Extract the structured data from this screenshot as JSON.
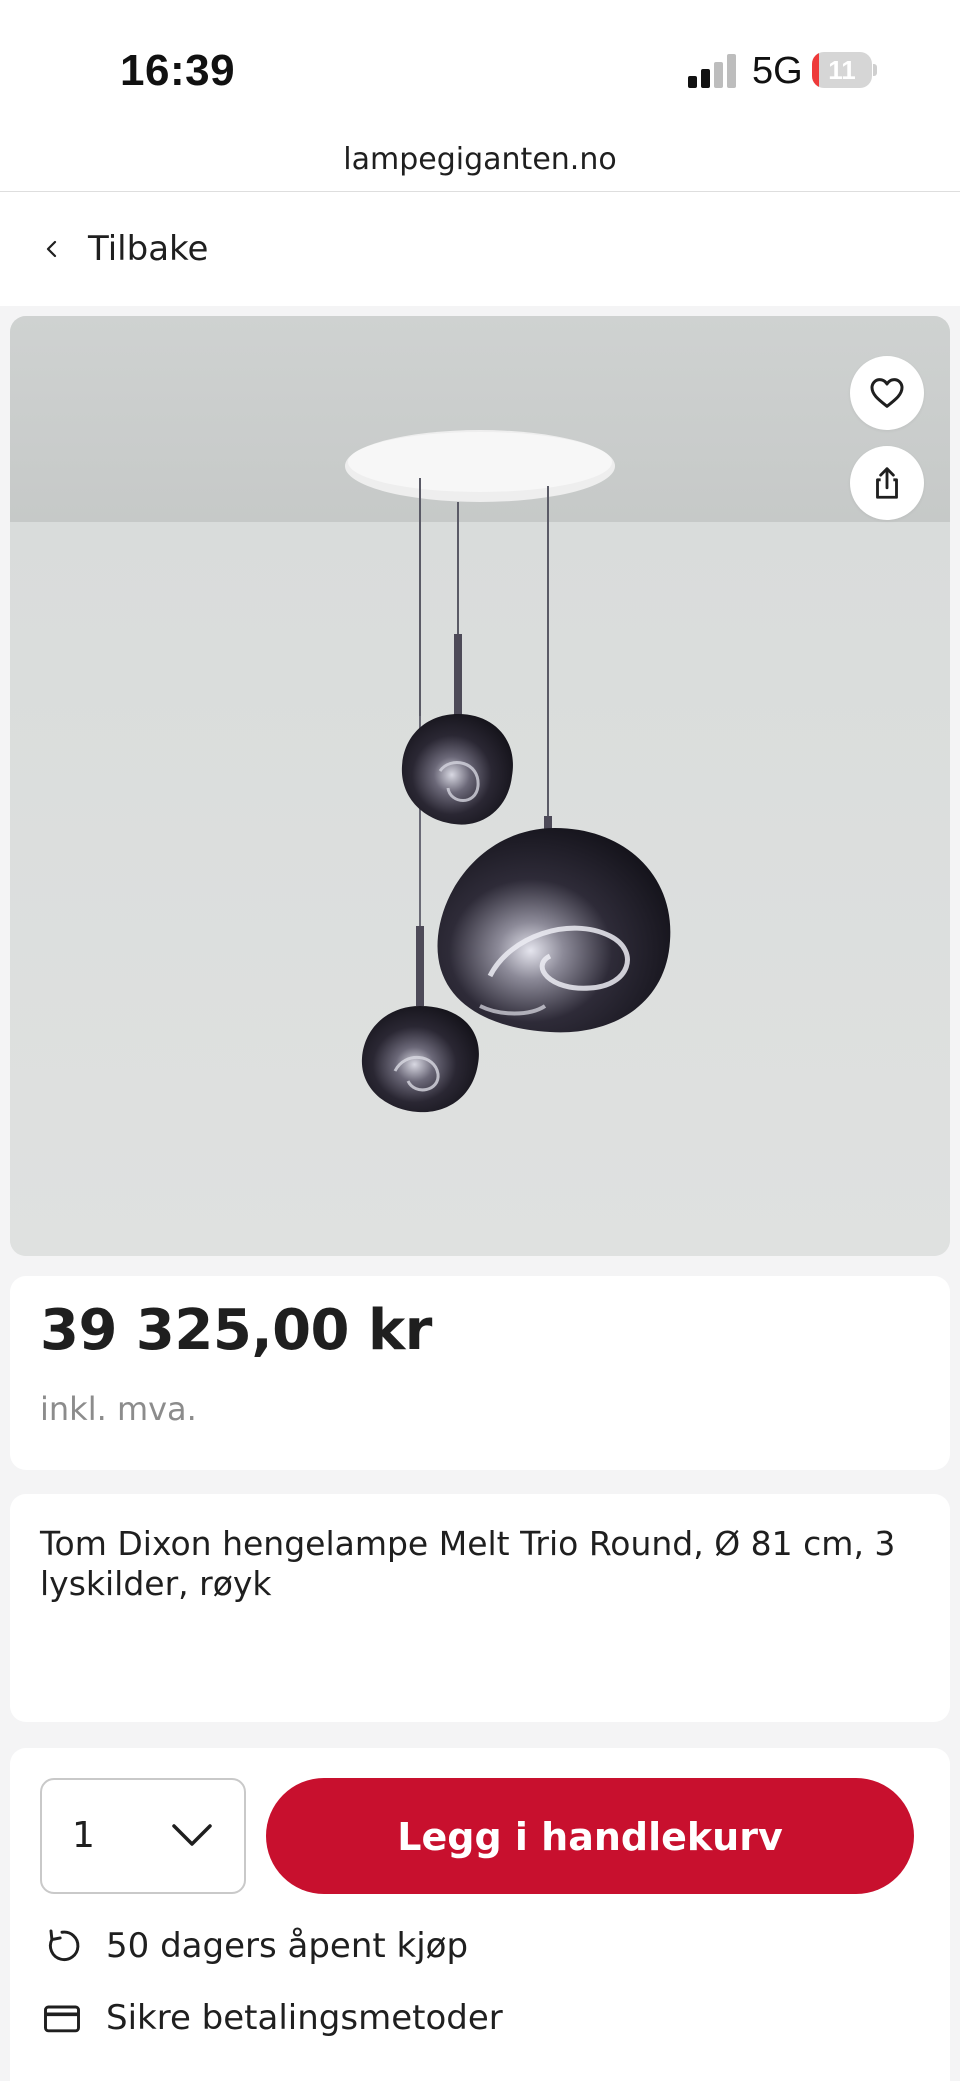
{
  "status_bar": {
    "time": "16:39",
    "network": "5G",
    "battery_level": "11",
    "battery_fraction": 0.11,
    "battery_color": "#ee3a3a"
  },
  "browser": {
    "url": "lampegiganten.no"
  },
  "nav": {
    "back_label": "Tilbake",
    "back_icon": "chevron-left-icon"
  },
  "product": {
    "image_icon_fav": "heart-icon",
    "image_icon_share": "share-icon",
    "price": "39 325,00 kr",
    "vat_note": "inkl. mva.",
    "title": "Tom Dixon hengelampe Melt Trio Round, Ø 81 cm, 3 lyskilder, røyk"
  },
  "purchase": {
    "quantity": "1",
    "add_to_cart_label": "Legg i handlekurv",
    "accent_color": "#c8102e",
    "benefits": [
      {
        "icon": "return-arrow-icon",
        "label": "50 dagers åpent kjøp"
      },
      {
        "icon": "credit-card-icon",
        "label": "Sikre betalingsmetoder"
      }
    ]
  }
}
